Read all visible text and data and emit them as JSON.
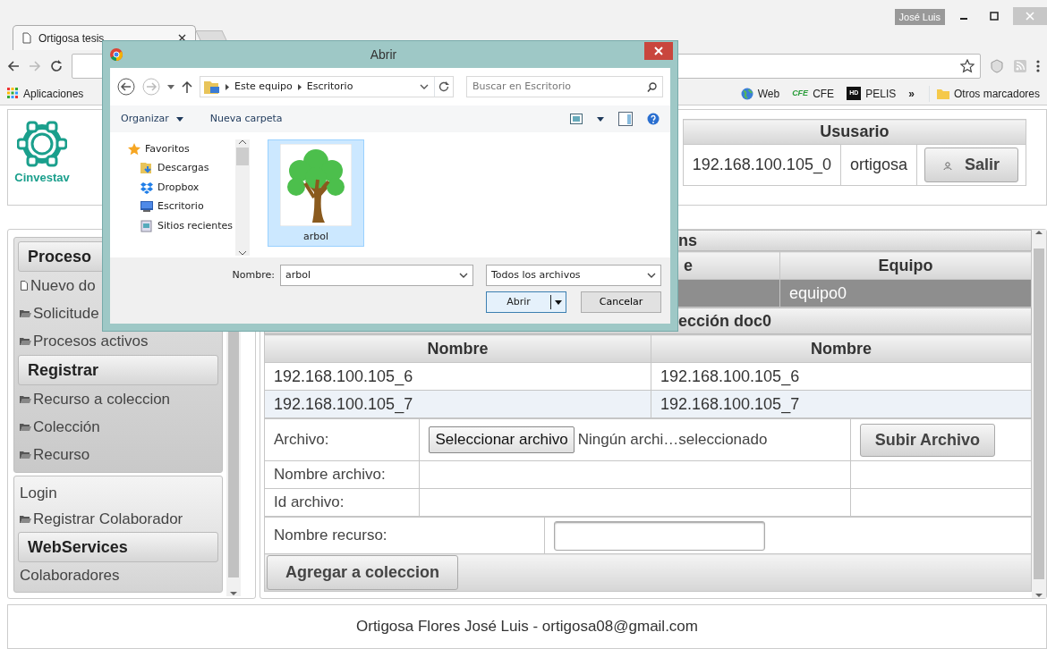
{
  "browser": {
    "tabs": [
      {
        "title": "Ortigosa tesis",
        "selected": true
      }
    ],
    "profile": "José Luis",
    "bookmarks": [
      {
        "label": "Aplicaciones",
        "kind": "apps"
      },
      {
        "label": "Web",
        "kind": "globe"
      },
      {
        "label": "CFE",
        "kind": "cfe",
        "icon_text": "CFE"
      },
      {
        "label": "PELIS",
        "kind": "hd",
        "icon_text": "HD"
      }
    ],
    "overflow": "»",
    "other_bookmarks": "Otros marcadores"
  },
  "header": {
    "logo_text": "Cinvestav",
    "user_table": {
      "title": "Ususario",
      "cells": [
        "192.168.100.105_0",
        "ortigosa"
      ],
      "button": "Salir"
    }
  },
  "sidebar": {
    "groups": [
      {
        "entries": [
          {
            "kind": "header",
            "label": "Proceso"
          },
          {
            "kind": "doc",
            "label": "Nuevo do"
          },
          {
            "kind": "folder",
            "label": "Solicitude"
          },
          {
            "kind": "folder",
            "label": "Procesos activos"
          },
          {
            "kind": "header",
            "label": "Registrar"
          },
          {
            "kind": "folder",
            "label": "Recurso a coleccion"
          },
          {
            "kind": "folder",
            "label": "Colección"
          },
          {
            "kind": "folder",
            "label": "Recurso"
          }
        ]
      },
      {
        "entries": [
          {
            "kind": "plain",
            "label": "Login"
          },
          {
            "kind": "folder",
            "label": "Registrar Colaborador"
          },
          {
            "kind": "header",
            "label": "WebServices"
          },
          {
            "kind": "plain",
            "label": "Colaboradores"
          }
        ]
      }
    ]
  },
  "main": {
    "title": "ns",
    "team_table": {
      "columns": [
        "e",
        "Equipo"
      ],
      "rows": [
        {
          "equipo": "equipo0",
          "selected": true
        }
      ]
    },
    "collection": {
      "title": "ección doc0",
      "columns": [
        "Nombre",
        "Nombre"
      ],
      "rows": [
        {
          "cells": [
            "192.168.100.105_6",
            "192.168.100.105_6"
          ],
          "selected": false
        },
        {
          "cells": [
            "192.168.100.105_7",
            "192.168.100.105_7"
          ],
          "selected": true
        }
      ]
    },
    "upload_form": {
      "file_label": "Archivo:",
      "file_button": "Seleccionar archivo",
      "file_status": "Ningún archi…seleccionado",
      "submit": "Subir Archivo",
      "rows": [
        {
          "label": "Nombre archivo:"
        },
        {
          "label": "Id archivo:"
        }
      ]
    },
    "resource_form": {
      "label": "Nombre recurso:",
      "button": "Agregar a coleccion"
    }
  },
  "footer": "Ortigosa Flores José Luis - ortigosa08@gmail.com",
  "dialog": {
    "title": "Abrir",
    "breadcrumb": [
      "Este equipo",
      "Escritorio"
    ],
    "search_placeholder": "Buscar en Escritorio",
    "commands": [
      "Organizar",
      "Nueva carpeta"
    ],
    "nav": [
      {
        "label": "Favoritos",
        "kind": "star",
        "children": [
          {
            "label": "Descargas",
            "kind": "downloads"
          },
          {
            "label": "Dropbox",
            "kind": "dropbox"
          },
          {
            "label": "Escritorio",
            "kind": "desktop"
          },
          {
            "label": "Sitios recientes",
            "kind": "recent"
          }
        ]
      }
    ],
    "files": [
      {
        "name": "arbol",
        "selected": true
      }
    ],
    "filename_label": "Nombre:",
    "filename": "arbol",
    "filetype": "Todos los archivos",
    "open_button": "Abrir",
    "cancel_button": "Cancelar"
  }
}
